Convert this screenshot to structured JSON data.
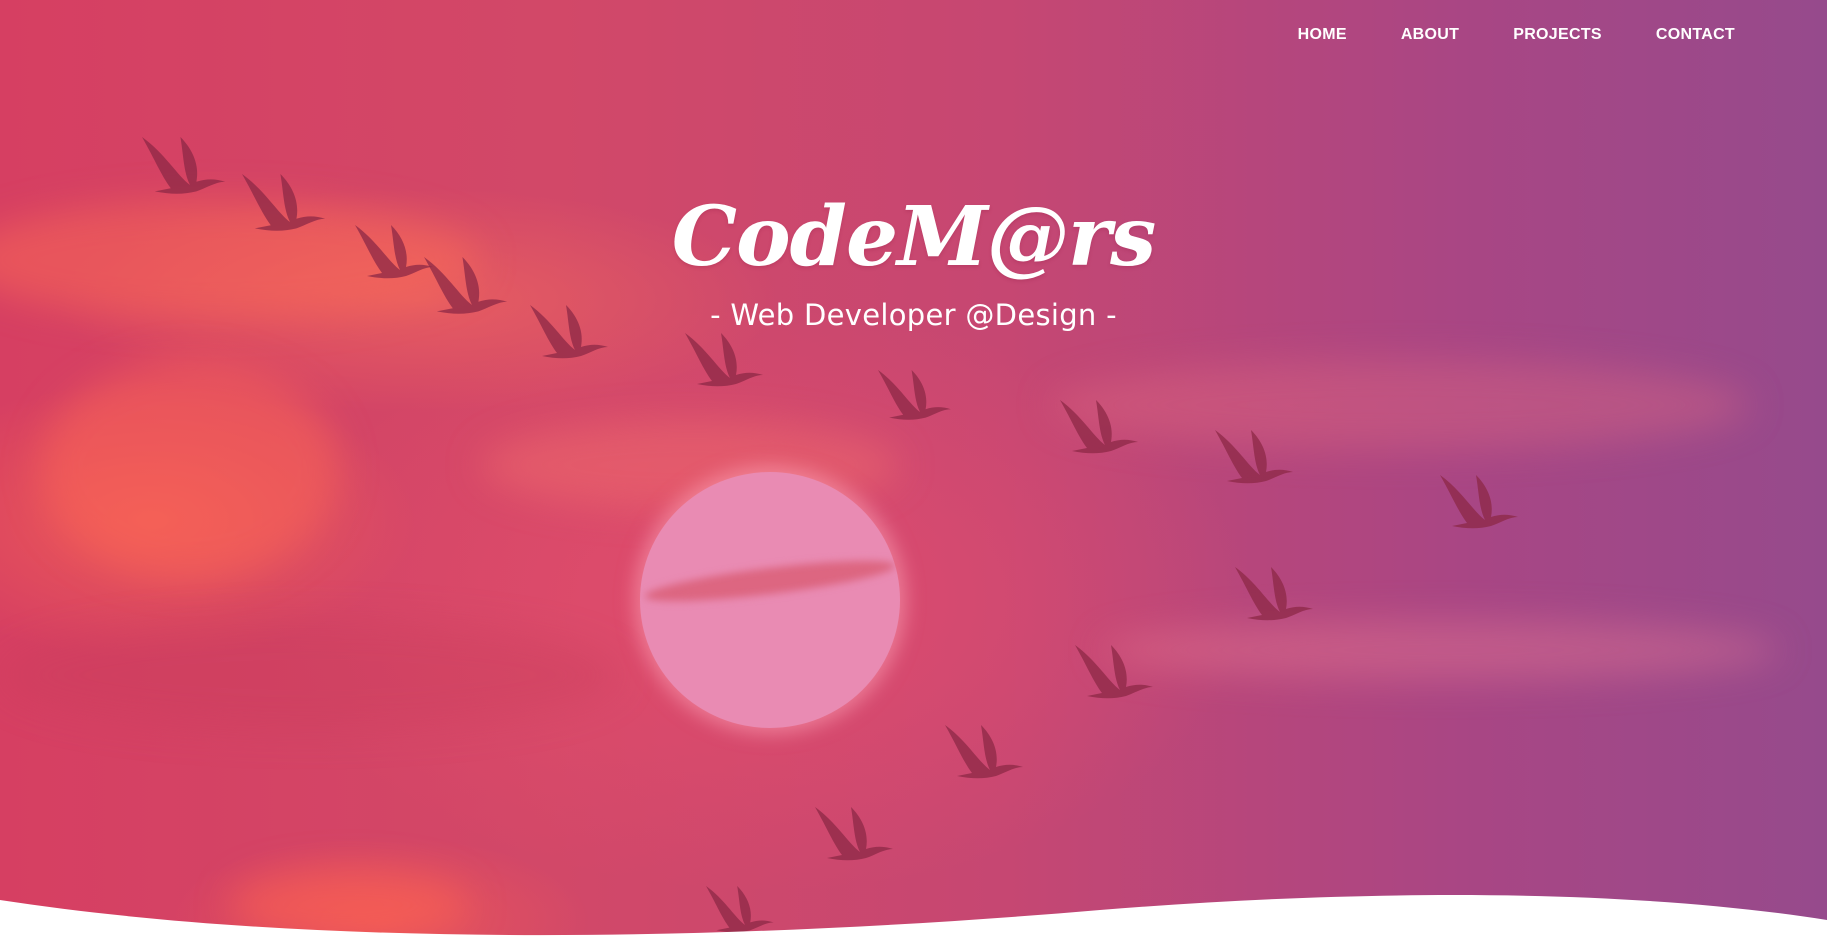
{
  "nav": {
    "items": [
      {
        "label": "HOME"
      },
      {
        "label": "ABOUT"
      },
      {
        "label": "PROJECTS"
      },
      {
        "label": "CONTACT"
      }
    ]
  },
  "hero": {
    "title": "CodeM@rs",
    "subtitle": "- Web Developer @Design -",
    "background_image": "sunset-sky-with-flock-of-birds",
    "colors": {
      "overlay_left": "#d63f62",
      "overlay_right": "#964a8c",
      "sun": "#e98bb3",
      "text": "#ffffff",
      "wave": "#ffffff"
    }
  }
}
